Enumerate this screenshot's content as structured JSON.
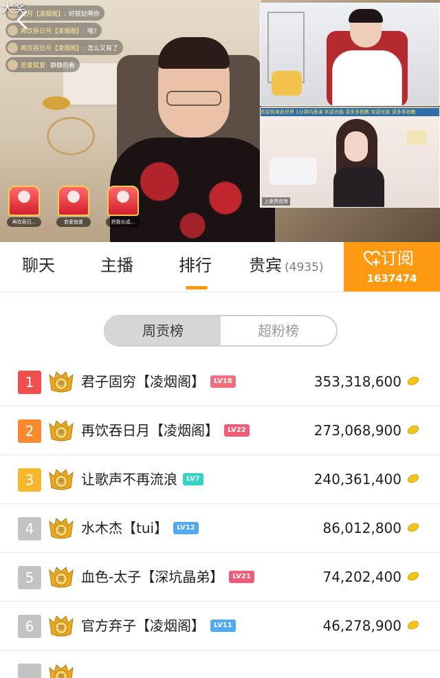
{
  "overlay": {
    "big_prize": "大奖"
  },
  "chat_messages": [
    {
      "user": "日月【凌烟阁】:",
      "text": "好就姑啊你"
    },
    {
      "user": "再饮吞日月【凌烟阁】:",
      "text": "哦?"
    },
    {
      "user": "再饮吞日月【凌烟阁】:",
      "text": "怎么又有了"
    },
    {
      "user": "若爱就爱:",
      "text": "静静的看"
    }
  ],
  "gifts": [
    {
      "name": "再饮吞日..."
    },
    {
      "name": "若爱就爱"
    },
    {
      "name": "把我长成..."
    }
  ],
  "pip_bottom": {
    "marquee": "欢迎你来此世界 1分钟内表演 欢迎光临 请多多指教 欢迎光临 请多多指教",
    "tag": "上座贵宾席"
  },
  "tabs": [
    {
      "label": "聊天"
    },
    {
      "label": "主播"
    },
    {
      "label": "排行"
    },
    {
      "label": "贵宾",
      "count": "(4935)"
    }
  ],
  "subscribe": {
    "label": "订阅",
    "count": "1637474"
  },
  "toggle": {
    "weekly": "周贡榜",
    "super_fans": "超粉榜"
  },
  "ranking": [
    {
      "rank": "1",
      "name": "君子固穷【凌烟阁】",
      "level": "LV18",
      "level_color": "#f26d7d",
      "rank_color": "#f0504d",
      "score": "353,318,600"
    },
    {
      "rank": "2",
      "name": "再饮吞日月【凌烟阁】",
      "level": "LV22",
      "level_color": "#f25a7a",
      "rank_color": "#f98a2e",
      "score": "273,068,900"
    },
    {
      "rank": "3",
      "name": "让歌声不再流浪",
      "level": "LV7",
      "level_color": "#35d2c6",
      "rank_color": "#f7b72d",
      "score": "240,361,400"
    },
    {
      "rank": "4",
      "name": "水木杰【tui】",
      "level": "LV12",
      "level_color": "#4fa9f3",
      "rank_color": "#c3c3c3",
      "score": "86,012,800"
    },
    {
      "rank": "5",
      "name": "血色-太子【深坑晶弟】",
      "level": "LV21",
      "level_color": "#f25a7a",
      "rank_color": "#c3c3c3",
      "score": "74,202,400"
    },
    {
      "rank": "6",
      "name": "官方弃子【凌烟阁】",
      "level": "LV11",
      "level_color": "#4fa9f3",
      "rank_color": "#c3c3c3",
      "score": "46,278,900"
    }
  ],
  "colors": {
    "accent": "#ff9a12",
    "coin": "#f5c518"
  }
}
